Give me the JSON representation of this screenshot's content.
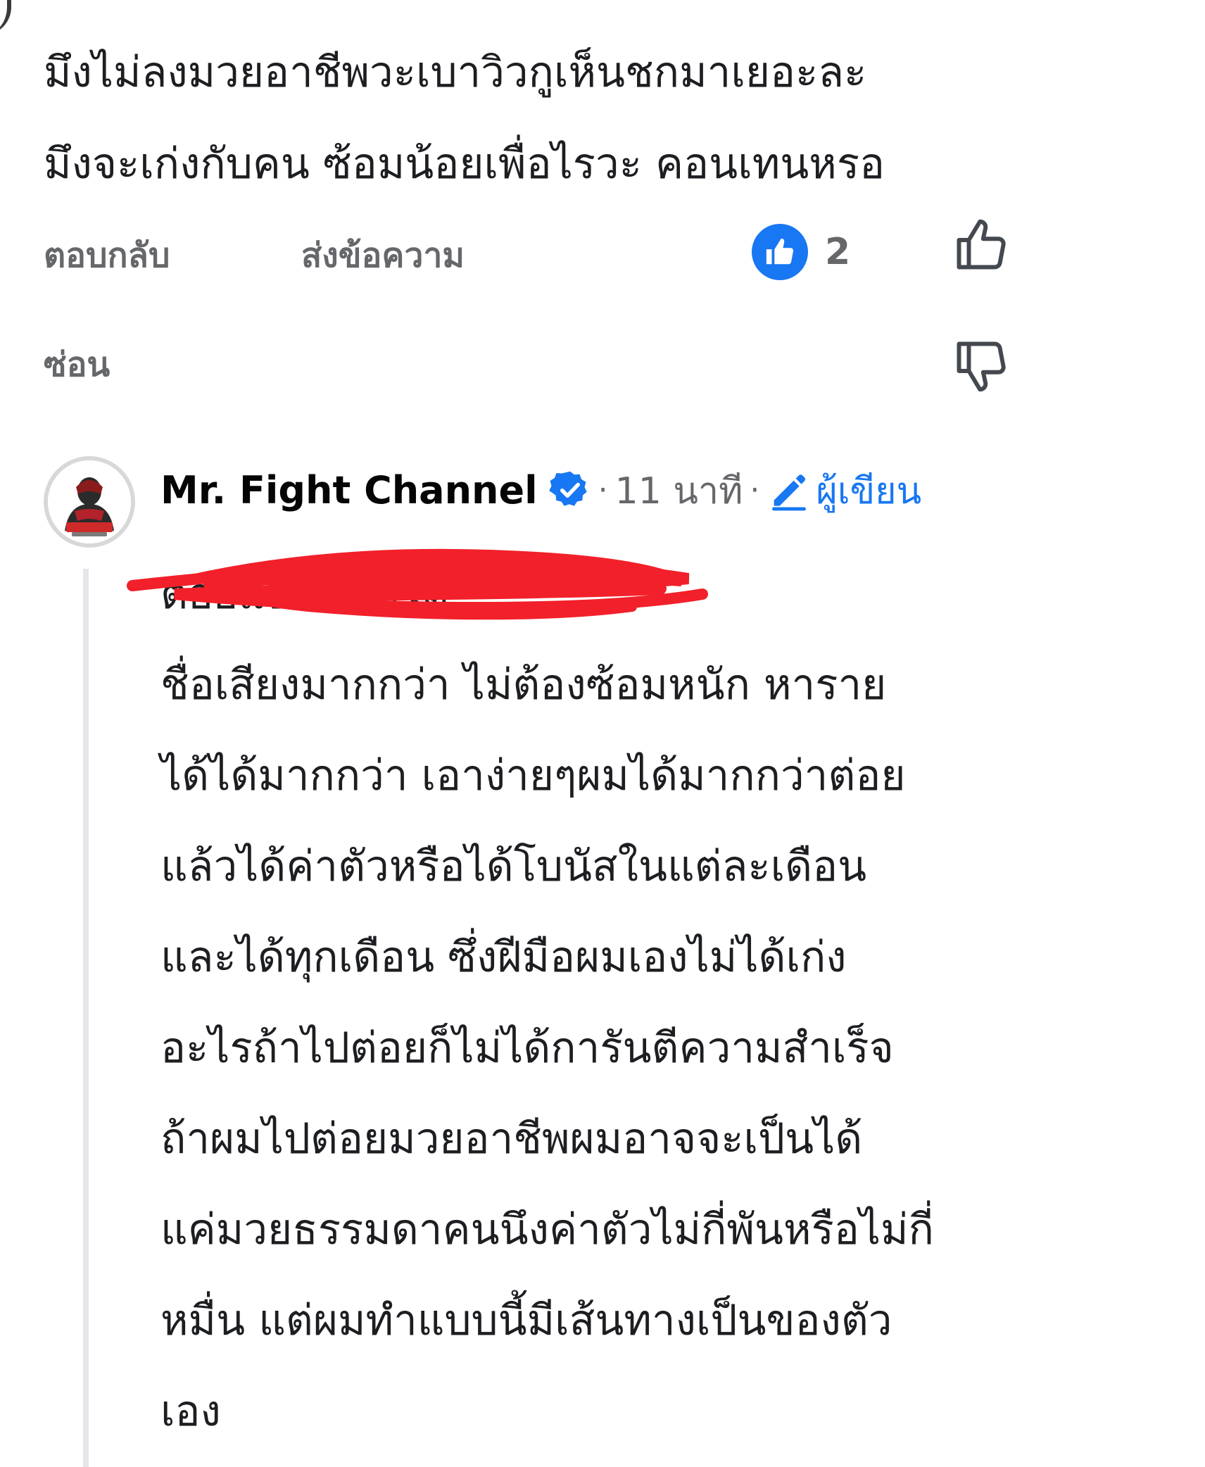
{
  "comment": {
    "text": "มึงไม่ลงมวยอาชีพวะเบาวิวกูเห็นชกมาเยอะละ\nมึงจะเก่งกับคน ซ้อมน้อยเพื่อไรวะ คอนเทนหรอ"
  },
  "actions": {
    "reply_label": "ตอบกลับ",
    "message_label": "ส่งข้อความ",
    "hide_label": "ซ่อน"
  },
  "reaction": {
    "icon": "thumbs-up-icon",
    "count": "2",
    "color": "#1877f2"
  },
  "vote_icons": [
    "thumbs-up-outline-icon",
    "thumbs-down-outline-icon"
  ],
  "reply": {
    "author": "Mr. Fight Channel",
    "verified": true,
    "separator": "·",
    "time": "11 นาที",
    "author_badge_label": "ผู้เขียน",
    "redacted_mention": "",
    "text": " ต่อยแบบนี้ผมได้\nชื่อเสียงมากกว่า ไม่ต้องซ้อมหนัก หาราย\nได้ได้มากกว่า เอาง่ายๆผมได้มากกว่าต่อย\nแล้วได้ค่าตัวหรือได้โบนัสในแต่ละเดือน\nและได้ทุกเดือน ซึ่งฝีมือผมเองไม่ได้เก่ง\nอะไรถ้าไปต่อยก็ไม่ได้การันตีความสำเร็จ\nถ้าผมไปต่อยมวยอาชีพผมอาจจะเป็นได้\nแค่มวยธรรมดาคนนึงค่าตัวไม่กี่พันหรือไม่กี่\nหมื่น แต่ผมทำแบบนี้มีเส้นทางเป็นของตัว\nเอง"
  },
  "colors": {
    "accent": "#1877f2",
    "muted_text": "#65676b",
    "redaction": "#f2202a"
  }
}
